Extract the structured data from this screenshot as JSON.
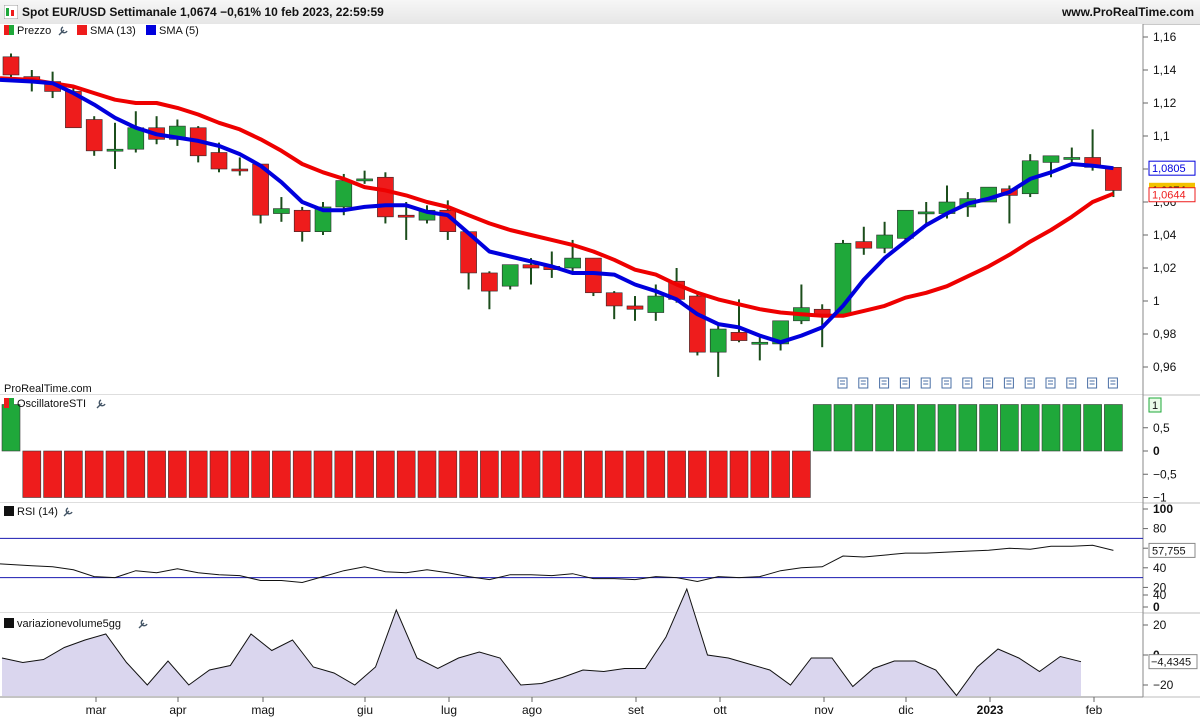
{
  "header": {
    "title": "Spot EUR/USD Settimanale 1,0674 −0,61% 10 feb 2023, 22:59:59",
    "brand": "www.ProRealTime.com"
  },
  "watermark": "ProRealTime.com",
  "colors": {
    "up": "#1fa83a",
    "down": "#ee1c1c",
    "sma13": "#ee0000",
    "sma5": "#0000dd",
    "wick": "#1b4d1b",
    "vol_fill": "#dad6ee"
  },
  "icons": [
    "wrench-icon",
    "report-icon"
  ],
  "panels": {
    "price": {
      "legend": [
        {
          "name": "Prezzo",
          "color": "#1fa83a",
          "icon": "wrench-icon"
        },
        {
          "name": "SMA (13)",
          "color": "#ee1c1c"
        },
        {
          "name": "SMA (5)",
          "color": "#0000dd"
        }
      ],
      "ticks": [
        "1,16",
        "1,14",
        "1,12",
        "1,1",
        "1,08",
        "1,06",
        "1,04",
        "1,02",
        "1",
        "0,98",
        "0,96"
      ],
      "badges": [
        {
          "text": "1,0805",
          "value": 1.0805,
          "color": "#0000dd",
          "style": "outline"
        },
        {
          "text": "1,0674",
          "value": 1.0674,
          "color": "#f2c200",
          "style": "fill"
        },
        {
          "text": "1,0644",
          "value": 1.0644,
          "color": "#ee1c1c",
          "style": "outline"
        }
      ]
    },
    "sti": {
      "name": "OscillatoreSTI",
      "ticks": [
        "1",
        "0,5",
        "0",
        "−0,5",
        "−1"
      ],
      "badge": "1"
    },
    "rsi": {
      "name": "RSI (14)",
      "ticks": [
        "100",
        "80",
        "60",
        "40",
        "20",
        "0"
      ],
      "badge": "57,755",
      "levels": [
        70,
        30
      ]
    },
    "volume": {
      "name": "variazionevolume5gg",
      "ticks": [
        "40",
        "20",
        "0",
        "−20"
      ],
      "badge": "−4,4345"
    }
  },
  "x_labels": [
    "mar",
    "apr",
    "mag",
    "giu",
    "lug",
    "ago",
    "set",
    "ott",
    "nov",
    "dic",
    "2023",
    "feb"
  ],
  "chart_data": [
    {
      "type": "candlestick",
      "title": "Spot EUR/USD Settimanale",
      "ylim": [
        0.95,
        1.165
      ],
      "candles": [
        [
          1.148,
          1.15,
          1.133,
          1.137
        ],
        [
          1.136,
          1.14,
          1.127,
          1.133
        ],
        [
          1.133,
          1.139,
          1.123,
          1.127
        ],
        [
          1.127,
          1.129,
          1.11,
          1.105
        ],
        [
          1.11,
          1.112,
          1.088,
          1.091
        ],
        [
          1.092,
          1.108,
          1.08,
          1.092
        ],
        [
          1.092,
          1.115,
          1.09,
          1.105
        ],
        [
          1.105,
          1.112,
          1.095,
          1.098
        ],
        [
          1.098,
          1.11,
          1.094,
          1.106
        ],
        [
          1.105,
          1.106,
          1.084,
          1.088
        ],
        [
          1.09,
          1.096,
          1.078,
          1.08
        ],
        [
          1.08,
          1.087,
          1.076,
          1.079
        ],
        [
          1.083,
          1.083,
          1.047,
          1.052
        ],
        [
          1.053,
          1.063,
          1.048,
          1.056
        ],
        [
          1.055,
          1.057,
          1.036,
          1.042
        ],
        [
          1.042,
          1.06,
          1.04,
          1.057
        ],
        [
          1.057,
          1.077,
          1.052,
          1.073
        ],
        [
          1.073,
          1.079,
          1.071,
          1.074
        ],
        [
          1.075,
          1.078,
          1.047,
          1.051
        ],
        [
          1.052,
          1.06,
          1.037,
          1.051
        ],
        [
          1.049,
          1.058,
          1.047,
          1.055
        ],
        [
          1.055,
          1.061,
          1.037,
          1.042
        ],
        [
          1.042,
          1.042,
          1.007,
          1.017
        ],
        [
          1.017,
          1.018,
          0.995,
          1.006
        ],
        [
          1.009,
          1.022,
          1.007,
          1.022
        ],
        [
          1.022,
          1.026,
          1.01,
          1.02
        ],
        [
          1.021,
          1.03,
          1.014,
          1.019
        ],
        [
          1.02,
          1.037,
          1.017,
          1.026
        ],
        [
          1.026,
          1.026,
          1.003,
          1.005
        ],
        [
          1.005,
          1.006,
          0.989,
          0.997
        ],
        [
          0.997,
          1.003,
          0.988,
          0.995
        ],
        [
          0.993,
          1.01,
          0.988,
          1.003
        ],
        [
          1.012,
          1.02,
          0.999,
          1.001
        ],
        [
          1.003,
          1.005,
          0.967,
          0.969
        ],
        [
          0.969,
          0.986,
          0.954,
          0.983
        ],
        [
          0.981,
          1.001,
          0.975,
          0.976
        ],
        [
          0.975,
          0.978,
          0.964,
          0.975
        ],
        [
          0.974,
          0.988,
          0.97,
          0.988
        ],
        [
          0.988,
          1.01,
          0.986,
          0.996
        ],
        [
          0.995,
          0.998,
          0.972,
          0.992
        ],
        [
          0.992,
          1.037,
          0.99,
          1.035
        ],
        [
          1.036,
          1.045,
          1.028,
          1.032
        ],
        [
          1.032,
          1.048,
          1.029,
          1.04
        ],
        [
          1.038,
          1.055,
          1.035,
          1.055
        ],
        [
          1.054,
          1.06,
          1.045,
          1.054
        ],
        [
          1.053,
          1.07,
          1.05,
          1.06
        ],
        [
          1.057,
          1.066,
          1.051,
          1.062
        ],
        [
          1.06,
          1.069,
          1.06,
          1.069
        ],
        [
          1.068,
          1.07,
          1.047,
          1.064
        ],
        [
          1.065,
          1.089,
          1.063,
          1.085
        ],
        [
          1.084,
          1.088,
          1.075,
          1.088
        ],
        [
          1.087,
          1.093,
          1.084,
          1.087
        ],
        [
          1.087,
          1.104,
          1.079,
          1.081
        ],
        [
          1.081,
          1.081,
          1.063,
          1.067
        ]
      ],
      "series": [
        {
          "name": "SMA (13)",
          "values": [
            1.135,
            1.134,
            1.132,
            1.13,
            1.126,
            1.122,
            1.12,
            1.12,
            1.117,
            1.113,
            1.108,
            1.104,
            1.098,
            1.091,
            1.083,
            1.078,
            1.074,
            1.069,
            1.067,
            1.064,
            1.06,
            1.057,
            1.052,
            1.047,
            1.043,
            1.04,
            1.037,
            1.034,
            1.03,
            1.025,
            1.019,
            1.016,
            1.01,
            1.005,
            1.001,
            0.998,
            0.995,
            0.993,
            0.992,
            0.991,
            0.991,
            0.994,
            0.997,
            1.002,
            1.005,
            1.009,
            1.015,
            1.021,
            1.028,
            1.036,
            1.043,
            1.051,
            1.06,
            1.065
          ]
        },
        {
          "name": "SMA (5)",
          "values": [
            1.134,
            1.133,
            1.132,
            1.126,
            1.119,
            1.111,
            1.105,
            1.101,
            1.099,
            1.097,
            1.094,
            1.089,
            1.082,
            1.072,
            1.06,
            1.055,
            1.055,
            1.057,
            1.058,
            1.058,
            1.054,
            1.052,
            1.041,
            1.03,
            1.027,
            1.024,
            1.021,
            1.017,
            1.017,
            1.016,
            1.01,
            1.006,
            1.001,
            0.992,
            0.986,
            0.984,
            0.979,
            0.975,
            0.979,
            0.984,
            0.997,
            1.013,
            1.026,
            1.036,
            1.046,
            1.053,
            1.059,
            1.062,
            1.066,
            1.074,
            1.078,
            1.083,
            1.082,
            1.0805
          ]
        }
      ]
    },
    {
      "type": "bar",
      "title": "OscillatoreSTI",
      "ylim": [
        -1.15,
        1.15
      ],
      "values": [
        1,
        -1,
        -1,
        -1,
        -1,
        -1,
        -1,
        -1,
        -1,
        -1,
        -1,
        -1,
        -1,
        -1,
        -1,
        -1,
        -1,
        -1,
        -1,
        -1,
        -1,
        -1,
        -1,
        -1,
        -1,
        -1,
        -1,
        -1,
        -1,
        -1,
        -1,
        -1,
        -1,
        -1,
        -1,
        -1,
        -1,
        -1,
        -1,
        1,
        1,
        1,
        1,
        1,
        1,
        1,
        1,
        1,
        1,
        1,
        1,
        1,
        1,
        1
      ]
    },
    {
      "type": "line",
      "title": "RSI (14)",
      "ylim": [
        0,
        100
      ],
      "values": [
        44,
        42,
        41,
        38,
        31,
        30,
        37,
        35,
        39,
        35,
        33,
        32,
        27,
        27,
        25,
        31,
        37,
        41,
        36,
        35,
        38,
        35,
        31,
        28,
        33,
        33,
        32,
        34,
        29,
        29,
        28,
        31,
        30,
        26,
        31,
        30,
        31,
        37,
        40,
        41,
        52,
        51,
        53,
        55,
        55,
        56,
        57,
        58,
        60,
        59,
        62,
        62,
        63,
        57.755
      ]
    },
    {
      "type": "area",
      "title": "variazionevolume5gg",
      "ylim": [
        -25,
        46
      ],
      "values": [
        -2,
        -5,
        -3,
        5,
        10,
        14,
        -5,
        -20,
        -4,
        -20,
        -10,
        -7,
        14,
        3,
        10,
        -8,
        -12,
        -20,
        -8,
        30,
        -2,
        -9,
        -2,
        2,
        -2,
        -20,
        -19,
        -15,
        -10,
        -11,
        -9,
        -9,
        12,
        44,
        0,
        -2,
        -6,
        -10,
        -20,
        -2,
        -2,
        -21,
        -9,
        -4,
        -4,
        -10,
        -27,
        -8,
        4,
        -2,
        -11,
        -1,
        -4.4345
      ]
    }
  ]
}
